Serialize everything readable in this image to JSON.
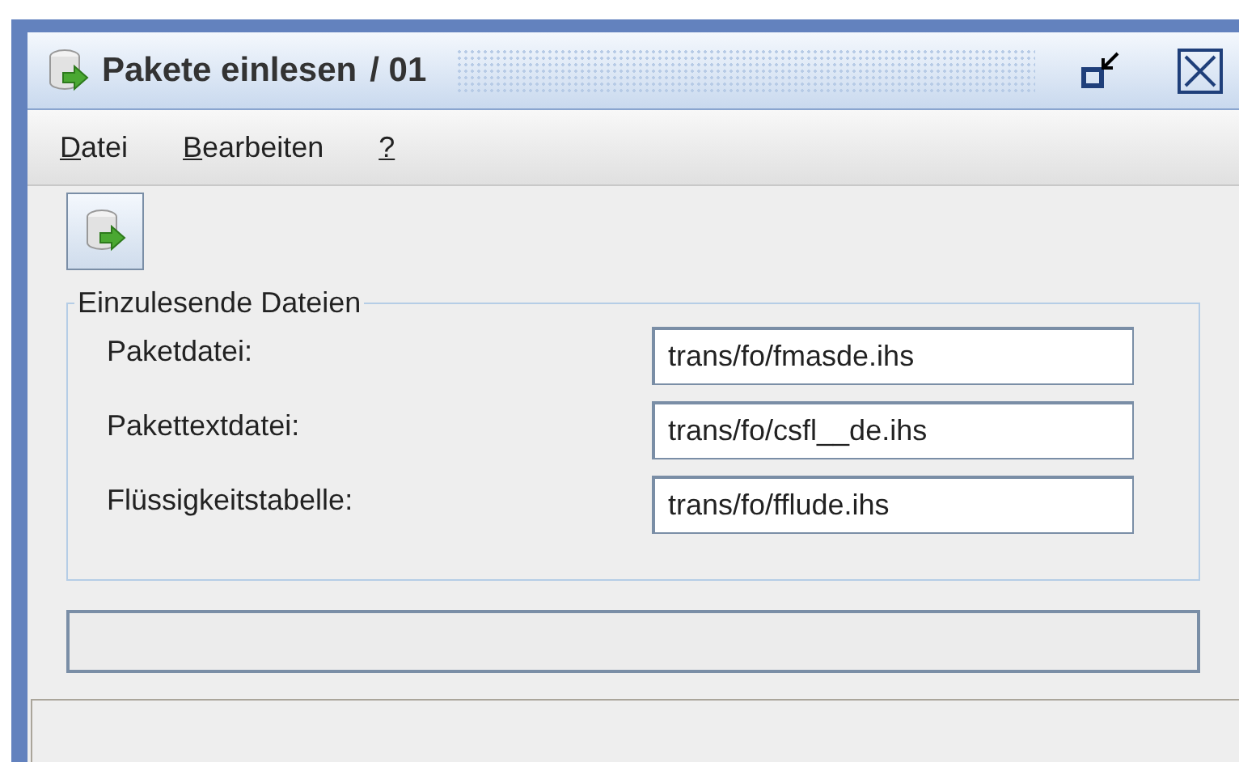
{
  "window": {
    "title": "Pakete einlesen",
    "number": "/ 01"
  },
  "menu": [
    {
      "label": "Datei",
      "underline_first": true
    },
    {
      "label": "Bearbeiten",
      "underline_first": true
    },
    {
      "label": "?",
      "underline_first": true
    }
  ],
  "group": {
    "title": "Einzulesende Dateien",
    "fields": [
      {
        "label": "Paketdatei:",
        "value": "trans/fo/fmasde.ihs"
      },
      {
        "label": "Pakettextdatei:",
        "value": "trans/fo/csfl__de.ihs"
      },
      {
        "label": "Flüssigkeitstabelle:",
        "value": "trans/fo/fflude.ihs"
      }
    ]
  },
  "progress": {
    "level": 0
  }
}
